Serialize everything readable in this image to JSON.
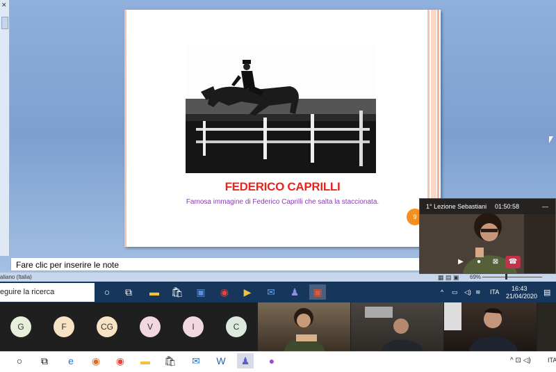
{
  "slide": {
    "title": "FEDERICO CAPRILLI",
    "caption": "Famosa immagine di Federico Caprilli che salta la staccionata.",
    "badge": "9"
  },
  "notes": {
    "placeholder": "Fare clic per inserire le note"
  },
  "status_bar": {
    "language": "aliano (Italia)",
    "zoom": "69%"
  },
  "taskbar_top": {
    "search_text": "eguire la ricerca",
    "language": "ITA",
    "time": "16:43",
    "date": "21/04/2020"
  },
  "call_overlay": {
    "title": "1° Lezione Sebastiani",
    "duration": "01:50:58",
    "minimize": "—"
  },
  "participants": [
    {
      "initial": "G",
      "color": "#e6efd9"
    },
    {
      "initial": "F",
      "color": "#f7e3c4"
    },
    {
      "initial": "CG",
      "color": "#f7e3c4"
    },
    {
      "initial": "V",
      "color": "#f3d7e0"
    },
    {
      "initial": "I",
      "color": "#f3d7e0"
    },
    {
      "initial": "C",
      "color": "#dbeadc"
    }
  ],
  "taskbar_bottom": {
    "language": "ITA"
  },
  "colors": {
    "slide_title": "#e8241c",
    "caption": "#8a3bb0",
    "badge": "#f5901e",
    "taskbar": "#16365b",
    "end_call": "#c4314b"
  }
}
